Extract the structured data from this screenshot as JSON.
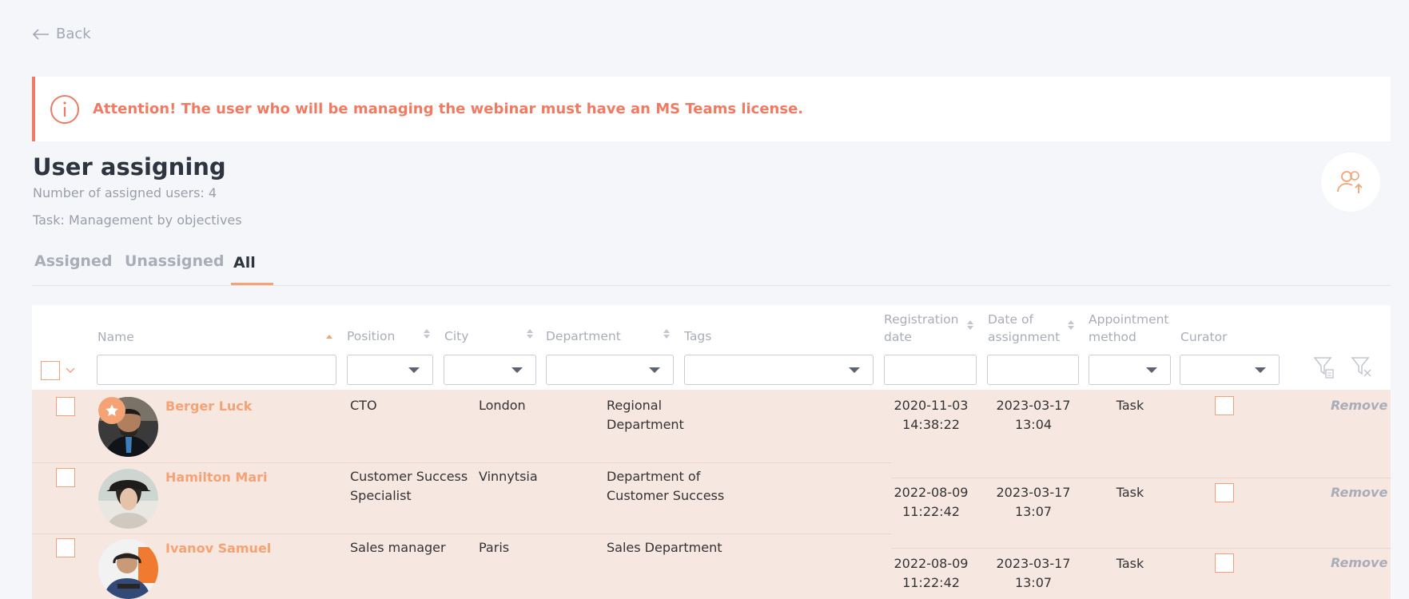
{
  "back_label": "Back",
  "alert": {
    "message": "Attention! The user who will be managing the webinar must have an MS Teams license."
  },
  "page": {
    "title": "User assigning",
    "assigned_count_text": "Number of assigned users: 4",
    "task_text": "Task: Management by objectives"
  },
  "tabs": [
    {
      "label": "Assigned"
    },
    {
      "label": "Unassigned"
    },
    {
      "label": "All",
      "active": true
    }
  ],
  "columns": {
    "name": "Name",
    "position": "Position",
    "city": "City",
    "department": "Department",
    "tags": "Tags",
    "registration_date": [
      "Registration",
      "date"
    ],
    "date_of_assignment": [
      "Date of",
      "assignment"
    ],
    "appointment_method": [
      "Appointment",
      "method"
    ],
    "curator": "Curator"
  },
  "rows": [
    {
      "name": "Berger Luck",
      "favorite": true,
      "position": [
        "CTO"
      ],
      "city": "London",
      "department": [
        "Regional",
        "Department"
      ],
      "registration": [
        "2020-11-03",
        "14:38:22"
      ],
      "assignment": [
        "2023-03-17",
        "13:04"
      ],
      "method": "Task",
      "remove": "Remove"
    },
    {
      "name": "Hamilton Mari",
      "favorite": false,
      "position": [
        "Customer Success",
        "Specialist"
      ],
      "city": "Vinnytsia",
      "department": [
        "Department of",
        "Customer Success"
      ],
      "registration": [
        "2022-08-09",
        "11:22:42"
      ],
      "assignment": [
        "2023-03-17",
        "13:07"
      ],
      "method": "Task",
      "remove": "Remove"
    },
    {
      "name": "Ivanov Samuel",
      "favorite": false,
      "position": [
        "Sales manager"
      ],
      "city": "Paris",
      "department": [
        "Sales Department"
      ],
      "registration": [
        "2022-08-09",
        "11:22:42"
      ],
      "assignment": [
        "2023-03-17",
        "13:07"
      ],
      "method": "Task",
      "remove": "Remove"
    }
  ],
  "colors": {
    "accent": "#f5a275",
    "alert": "#f07b62",
    "row_bg": "#f7e7e1"
  }
}
